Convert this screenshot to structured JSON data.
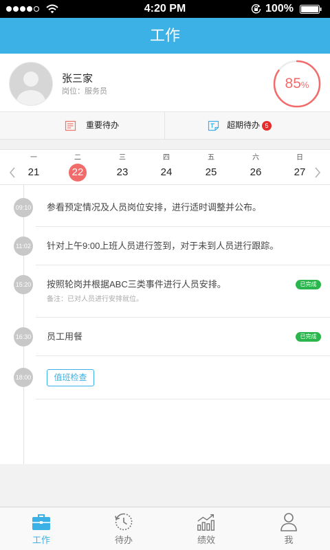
{
  "status_bar": {
    "signal_bars": 4,
    "signal_max": 5,
    "time": "4:20 PM",
    "battery": "100%",
    "icons": [
      "signal-dots-icon",
      "wifi-icon",
      "rotation-lock-icon",
      "battery-icon"
    ]
  },
  "header": {
    "title": "工作"
  },
  "profile": {
    "avatar_icon": "default-avatar-icon",
    "name": "张三家",
    "position": "岗位：服务员",
    "progress": {
      "value": "85",
      "unit": "%",
      "fraction": 0.85
    }
  },
  "todo_tabs": [
    {
      "label": "重要待办",
      "icon": "important-todo-icon"
    },
    {
      "label": "超期待办",
      "icon": "overdue-todo-icon",
      "badge": "5"
    }
  ],
  "calendar": {
    "weekdays": [
      "一",
      "二",
      "三",
      "四",
      "五",
      "六",
      "日"
    ],
    "dates": [
      "21",
      "22",
      "23",
      "24",
      "25",
      "26",
      "27"
    ],
    "selected_date": "22",
    "prev_icon": "chevron-left-icon",
    "next_icon": "chevron-right-icon"
  },
  "timeline": [
    {
      "time": "09:10",
      "text": "参看预定情况及人员岗位安排，进行适时调整并公布。"
    },
    {
      "time": "11:02",
      "text": "针对上午9:00上班人员进行签到，对于未到人员进行跟踪。"
    },
    {
      "time": "15:20",
      "text": "按照轮岗并根据ABC三类事件进行人员安排。",
      "status": "已完成",
      "note": "备注：已对人员进行安排就位。"
    },
    {
      "time": "16:30",
      "text": "员工用餐",
      "status": "已完成"
    },
    {
      "time": "18:00",
      "action_label": "值班检查"
    }
  ],
  "tabbar": [
    {
      "label": "工作",
      "icon": "briefcase-icon",
      "active": true
    },
    {
      "label": "待办",
      "icon": "clock-icon",
      "active": false
    },
    {
      "label": "绩效",
      "icon": "chart-icon",
      "active": false
    },
    {
      "label": "我",
      "icon": "person-icon",
      "active": false
    }
  ],
  "colors": {
    "primary": "#3cb1e6",
    "accent_red": "#f26b6b",
    "success_green": "#2ab54d",
    "timeline_dot": "#c8c8c8",
    "badge_red": "#e62d2d"
  }
}
